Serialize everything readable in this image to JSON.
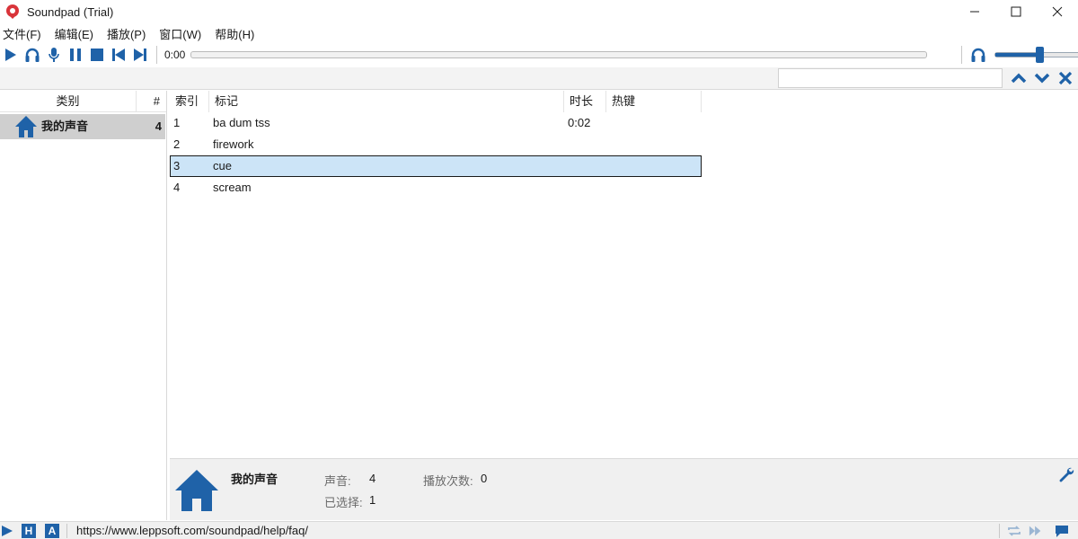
{
  "window": {
    "title": "Soundpad (Trial)"
  },
  "menu": [
    {
      "label": "文件(F)"
    },
    {
      "label": "编辑(E)"
    },
    {
      "label": "播放(P)"
    },
    {
      "label": "窗口(W)"
    },
    {
      "label": "帮助(H)"
    }
  ],
  "toolbar": {
    "time": "0:00",
    "progress": 0,
    "volume": 0.5,
    "icons": [
      "play-icon",
      "headphones-icon",
      "microphone-icon",
      "pause-icon",
      "stop-icon",
      "previous-icon",
      "next-icon"
    ]
  },
  "search": {
    "value": "",
    "icons": [
      "arrow-up-icon",
      "arrow-down-icon",
      "close-icon"
    ]
  },
  "categories": {
    "header": {
      "category": "类别",
      "count": "#"
    },
    "items": [
      {
        "name": "我的声音",
        "count": "4"
      }
    ]
  },
  "sounds": {
    "columns": {
      "index": "索引",
      "tag": "标记",
      "duration": "时长",
      "hotkey": "热键"
    },
    "rows": [
      {
        "index": "1",
        "tag": "ba dum tss",
        "duration": "0:02",
        "hotkey": ""
      },
      {
        "index": "2",
        "tag": "firework",
        "duration": "",
        "hotkey": ""
      },
      {
        "index": "3",
        "tag": "cue",
        "duration": "",
        "hotkey": ""
      },
      {
        "index": "4",
        "tag": "scream",
        "duration": "",
        "hotkey": ""
      }
    ],
    "selected_index": "3"
  },
  "info": {
    "name": "我的声音",
    "sounds_label": "声音:",
    "sounds_value": "4",
    "selected_label": "已选择:",
    "selected_value": "1",
    "plays_label": "播放次数:",
    "plays_value": "0"
  },
  "statusbar": {
    "h_label": "H",
    "a_label": "A",
    "text": "https://www.leppsoft.com/soundpad/help/faq/"
  },
  "colors": {
    "accent": "#1f62a8",
    "selection": "#cce4f7",
    "category_selected": "#cfcfcf"
  }
}
